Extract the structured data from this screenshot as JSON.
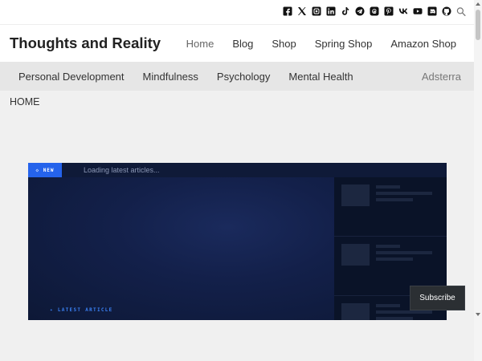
{
  "social": {
    "icons": [
      "facebook-icon",
      "x-icon",
      "instagram-icon",
      "linkedin-icon",
      "tiktok-icon",
      "telegram-icon",
      "threads-icon",
      "pinterest-icon",
      "vk-icon",
      "youtube-icon",
      "discord-icon",
      "github-icon",
      "search-icon"
    ]
  },
  "header": {
    "site_title": "Thoughts and Reality",
    "nav": [
      "Home",
      "Blog",
      "Shop",
      "Spring Shop",
      "Amazon Shop"
    ]
  },
  "subnav": {
    "items": [
      "Personal Development",
      "Mindfulness",
      "Psychology",
      "Mental Health"
    ],
    "ad_label": "Adsterra"
  },
  "breadcrumb": "HOME",
  "widget": {
    "badge": "◇ NEW",
    "ticker": "Loading latest articles...",
    "feature_label": "✦ LATEST ARTICLE"
  },
  "subscribe_label": "Subscribe",
  "colors": {
    "accent": "#2563eb",
    "widget_bg": "#0c1630",
    "page_bg": "#f0f0f0"
  }
}
